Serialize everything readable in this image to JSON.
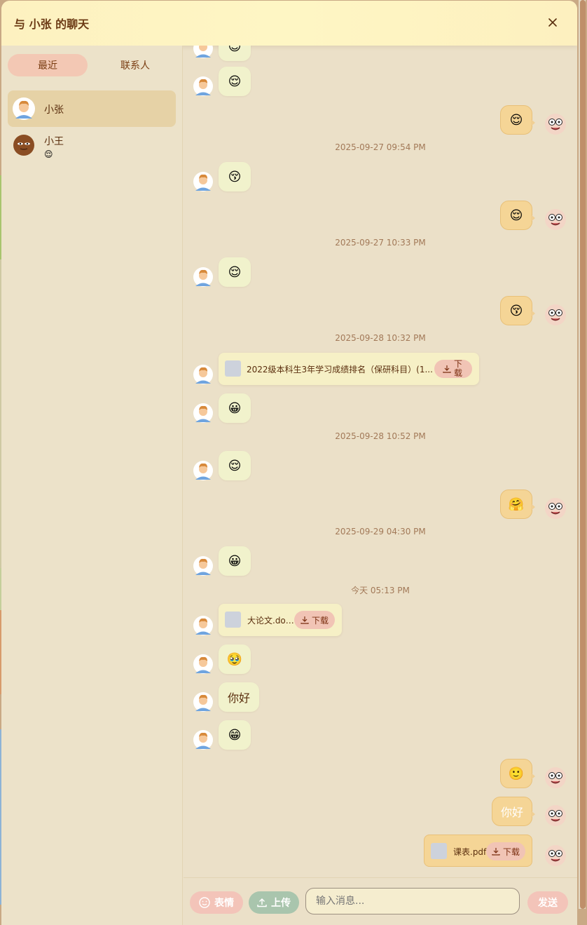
{
  "window": {
    "title": "与 小张 的聊天"
  },
  "sidebar": {
    "tabs": [
      {
        "label": "最近"
      },
      {
        "label": "联系人"
      }
    ],
    "contacts": [
      {
        "name": "小张",
        "last_message": ""
      },
      {
        "name": "小王",
        "last_message": "😌"
      }
    ]
  },
  "messages": {
    "m1": "😌",
    "m2": "😌",
    "m3": "😌",
    "ts1": "2025-09-27 09:54 PM",
    "m4": "😚",
    "m5": "😌",
    "ts2": "2025-09-27 10:33 PM",
    "m6": "😌",
    "m7": "😚",
    "ts3": "2025-09-28 10:32 PM",
    "file1": {
      "name": "2022级本科生3年学习成绩排名（保研科目）(1...",
      "download": "下载"
    },
    "m8": "😀",
    "ts4": "2025-09-28 10:52 PM",
    "m9": "😌",
    "m10": "🤗",
    "ts5": "2025-09-29 04:30 PM",
    "m11": "😀",
    "ts6": "今天 05:13 PM",
    "file2": {
      "name": "大论文.docx",
      "download": "下载"
    },
    "m12": "🥹",
    "m13": "你好",
    "m14": "😁",
    "m15": "🙂",
    "m16": "你好",
    "file3": {
      "name": "课表.pdf",
      "download": "下载"
    }
  },
  "footer": {
    "emoji_label": "表情",
    "upload_label": "上传",
    "input_placeholder": "输入消息...",
    "input_value": "",
    "send_label": "发送"
  },
  "colors": {
    "header_bg": "#fef4c2",
    "panel_bg": "#ebe0c8",
    "accent_text": "#6b3a14",
    "self_bubble": "#f5d596",
    "other_bubble": "#f1f2cc",
    "emoji_button": "#f3c4b9",
    "upload_button": "#a9c5ad",
    "send_button": "#f3c4b9"
  }
}
